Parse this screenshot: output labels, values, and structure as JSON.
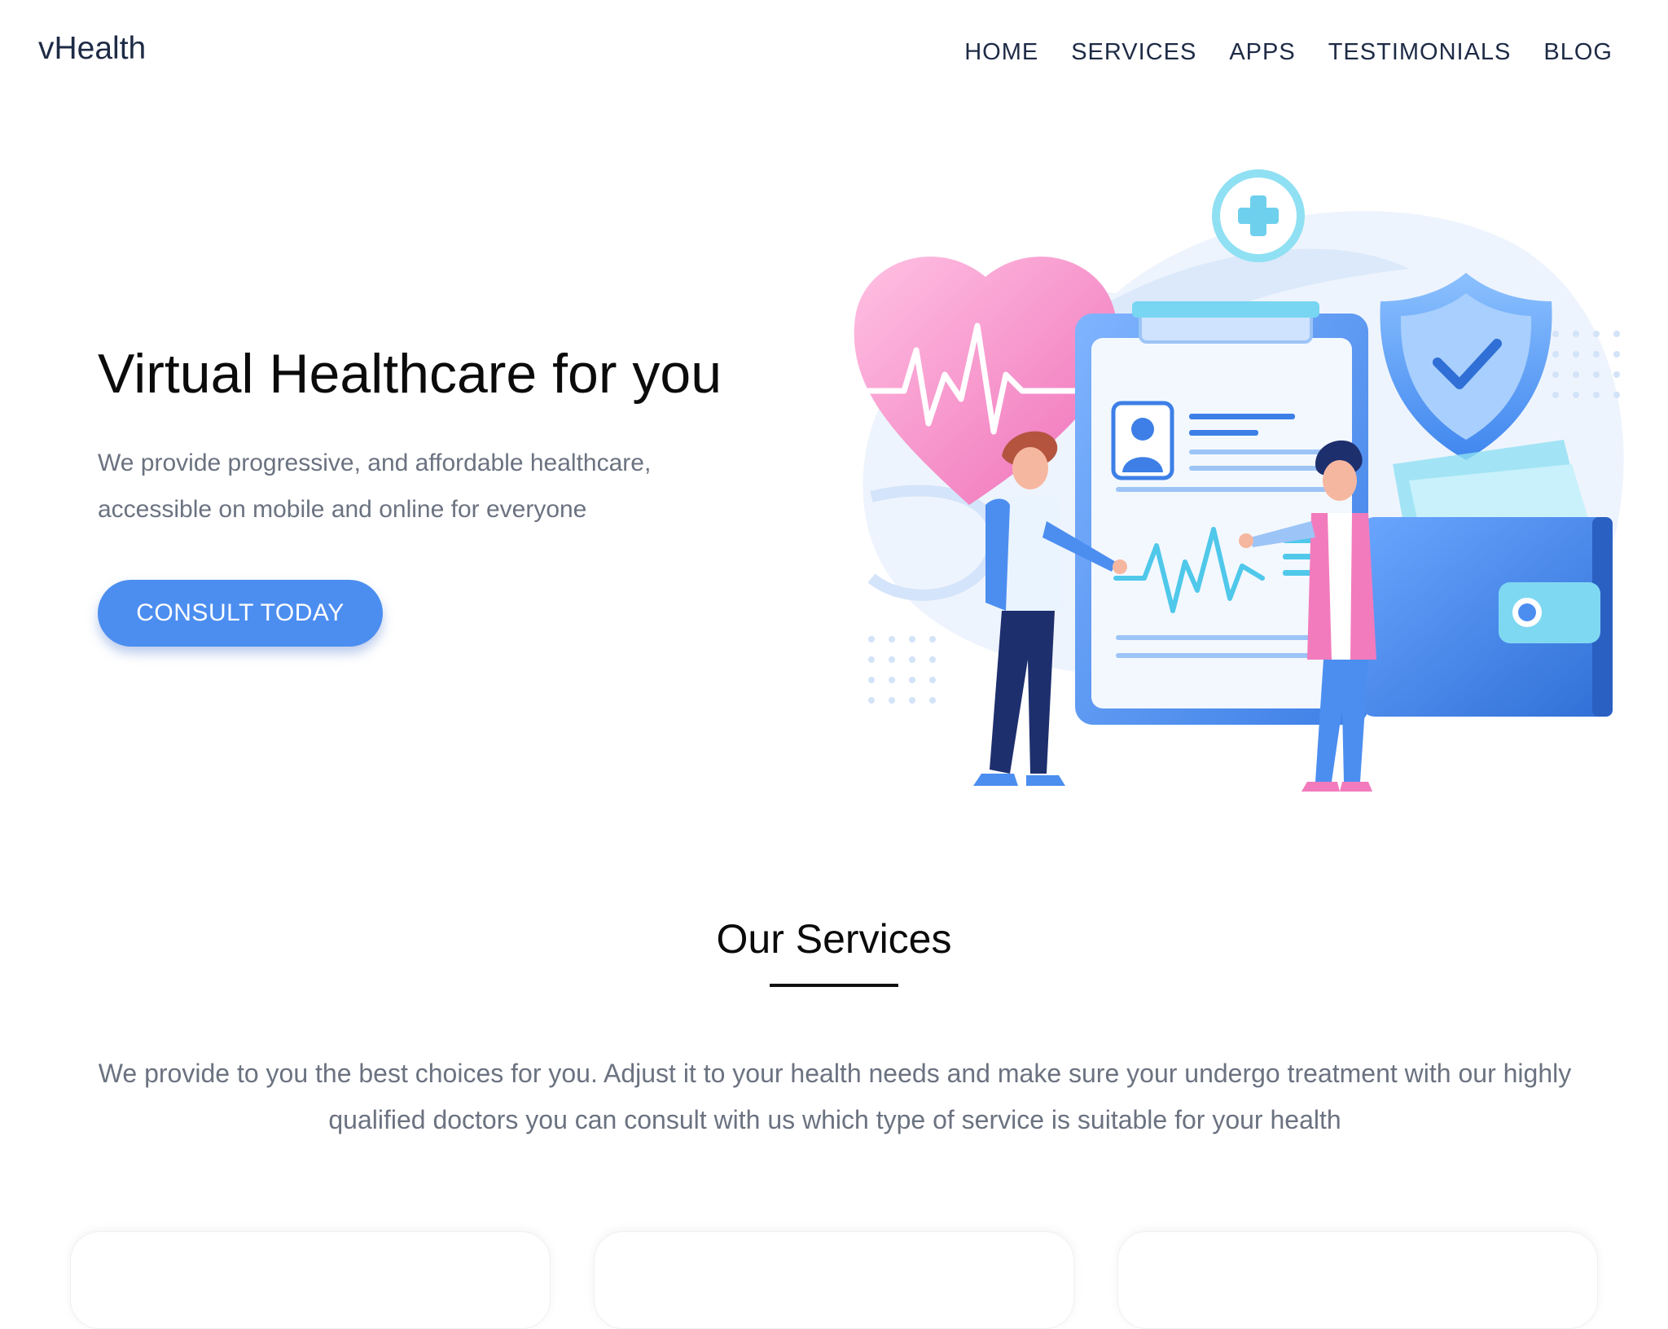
{
  "nav": {
    "brand": "vHealth",
    "links": [
      "HOME",
      "SERVICES",
      "APPS",
      "TESTIMONIALS",
      "BLOG"
    ]
  },
  "hero": {
    "title": "Virtual Healthcare for you",
    "subtitle": "We provide progressive, and affordable healthcare, accessible on mobile and online for everyone",
    "cta_label": "CONSULT TODAY"
  },
  "services": {
    "title": "Our Services",
    "description": "We provide to you the best choices for you. Adjust it to your health needs and make sure your undergo treatment with our highly qualified doctors you can consult with us which type of service is suitable for your health"
  },
  "colors": {
    "accent": "#4c8ef0",
    "text_dark": "#1e2b46",
    "text_muted": "#6b7280",
    "illustration_pink": "#f27bbd",
    "illustration_blue": "#4c8ef0"
  }
}
